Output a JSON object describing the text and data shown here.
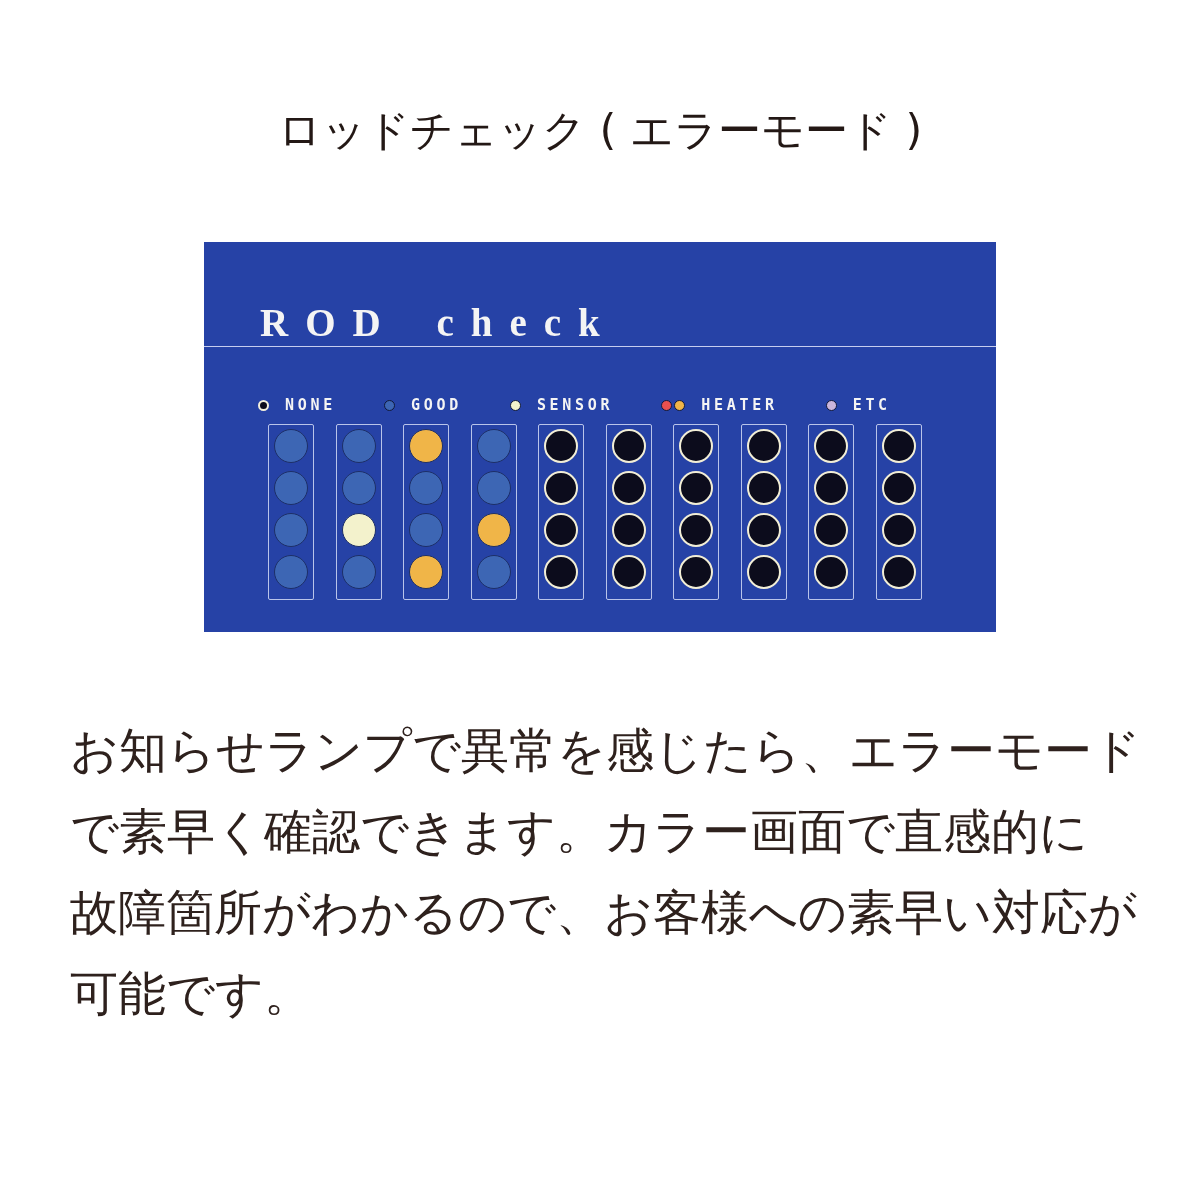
{
  "title": "ロッドチェック ( エラーモード )",
  "panel": {
    "title": "ROD check",
    "legend": [
      {
        "label": "NONE",
        "dots": [
          {
            "kind": "ring",
            "color": "#0c0c1c"
          }
        ]
      },
      {
        "label": "GOOD",
        "dots": [
          {
            "kind": "dot",
            "color": "#3d66b4"
          }
        ]
      },
      {
        "label": "SENSOR",
        "dots": [
          {
            "kind": "dot",
            "color": "#f3f2cc"
          }
        ]
      },
      {
        "label": "HEATER",
        "dots": [
          {
            "kind": "dot",
            "color": "#e9504f"
          },
          {
            "kind": "dot",
            "color": "#f0b548"
          }
        ]
      },
      {
        "label": "ETC",
        "dots": [
          {
            "kind": "dot",
            "color": "#ccb6dc"
          }
        ]
      }
    ],
    "columns": [
      {
        "lamps": [
          {
            "kind": "dot",
            "color": "#3d66b4"
          },
          {
            "kind": "dot",
            "color": "#3d66b4"
          },
          {
            "kind": "dot",
            "color": "#3d66b4"
          },
          {
            "kind": "dot",
            "color": "#3d66b4"
          }
        ]
      },
      {
        "lamps": [
          {
            "kind": "dot",
            "color": "#3d66b4"
          },
          {
            "kind": "dot",
            "color": "#3d66b4"
          },
          {
            "kind": "dot",
            "color": "#f3f2cc"
          },
          {
            "kind": "dot",
            "color": "#3d66b4"
          }
        ]
      },
      {
        "lamps": [
          {
            "kind": "dot",
            "color": "#f0b548"
          },
          {
            "kind": "dot",
            "color": "#3d66b4"
          },
          {
            "kind": "dot",
            "color": "#3d66b4"
          },
          {
            "kind": "dot",
            "color": "#f0b548"
          }
        ]
      },
      {
        "lamps": [
          {
            "kind": "dot",
            "color": "#3d66b4"
          },
          {
            "kind": "dot",
            "color": "#3d66b4"
          },
          {
            "kind": "dot",
            "color": "#f0b548"
          },
          {
            "kind": "dot",
            "color": "#3d66b4"
          }
        ]
      },
      {
        "lamps": [
          {
            "kind": "ring",
            "color": "#0c0c1c"
          },
          {
            "kind": "ring",
            "color": "#0c0c1c"
          },
          {
            "kind": "ring",
            "color": "#0c0c1c"
          },
          {
            "kind": "ring",
            "color": "#0c0c1c"
          }
        ]
      },
      {
        "lamps": [
          {
            "kind": "ring",
            "color": "#0c0c1c"
          },
          {
            "kind": "ring",
            "color": "#0c0c1c"
          },
          {
            "kind": "ring",
            "color": "#0c0c1c"
          },
          {
            "kind": "ring",
            "color": "#0c0c1c"
          }
        ]
      },
      {
        "lamps": [
          {
            "kind": "ring",
            "color": "#0c0c1c"
          },
          {
            "kind": "ring",
            "color": "#0c0c1c"
          },
          {
            "kind": "ring",
            "color": "#0c0c1c"
          },
          {
            "kind": "ring",
            "color": "#0c0c1c"
          }
        ]
      },
      {
        "lamps": [
          {
            "kind": "ring",
            "color": "#0c0c1c"
          },
          {
            "kind": "ring",
            "color": "#0c0c1c"
          },
          {
            "kind": "ring",
            "color": "#0c0c1c"
          },
          {
            "kind": "ring",
            "color": "#0c0c1c"
          }
        ]
      },
      {
        "lamps": [
          {
            "kind": "ring",
            "color": "#0c0c1c"
          },
          {
            "kind": "ring",
            "color": "#0c0c1c"
          },
          {
            "kind": "ring",
            "color": "#0c0c1c"
          },
          {
            "kind": "ring",
            "color": "#0c0c1c"
          }
        ]
      },
      {
        "lamps": [
          {
            "kind": "ring",
            "color": "#0c0c1c"
          },
          {
            "kind": "ring",
            "color": "#0c0c1c"
          },
          {
            "kind": "ring",
            "color": "#0c0c1c"
          },
          {
            "kind": "ring",
            "color": "#0c0c1c"
          }
        ]
      }
    ]
  },
  "description": [
    "お知らせランプで異常を感じたら、エラーモード",
    "で素早く確認できます。カラー画面で直感的に",
    "故障箇所がわかるので、お客様への素早い対応が",
    "可能です。"
  ]
}
